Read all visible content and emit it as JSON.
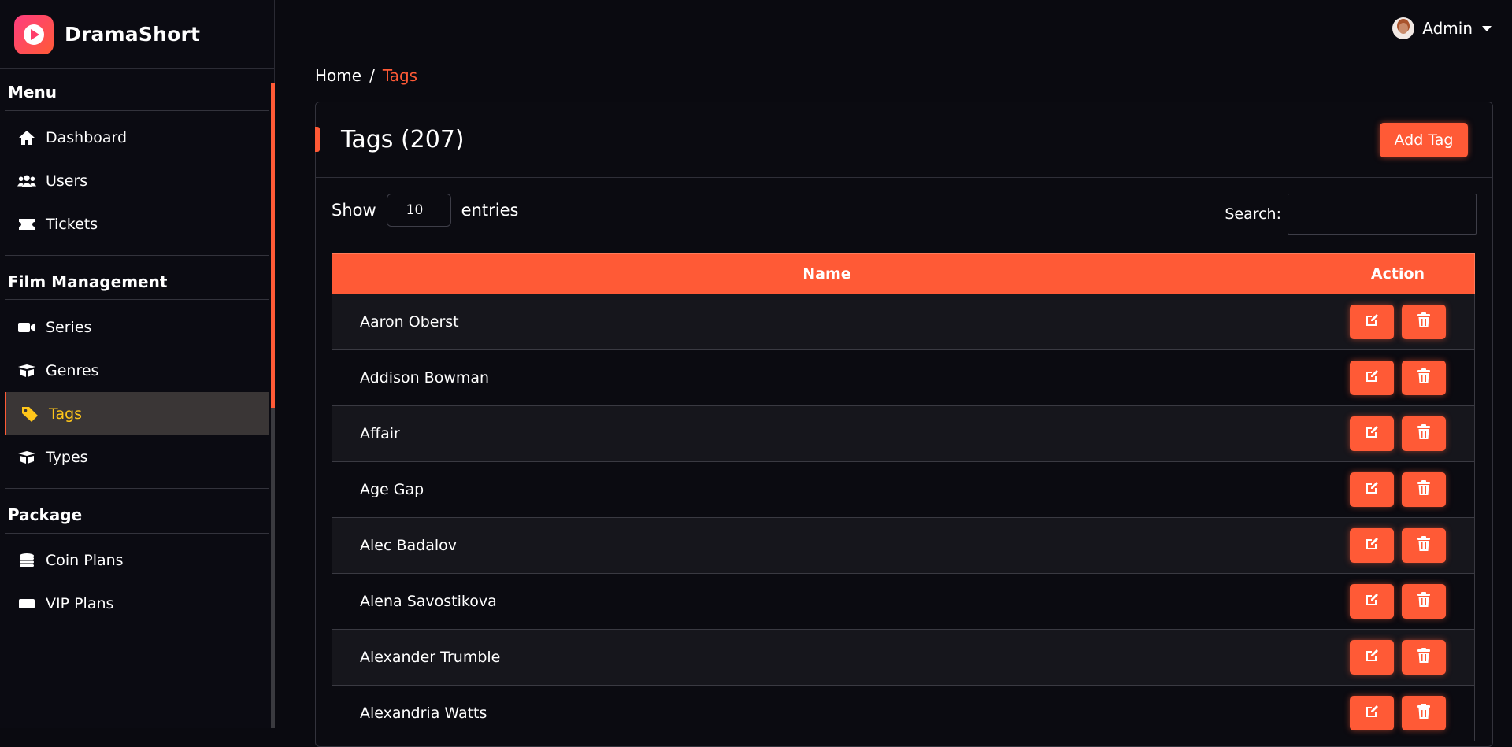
{
  "app": {
    "name": "DramaShort",
    "colors": {
      "accent": "#ff5a36",
      "active_text": "#ffc61a"
    }
  },
  "sidebar": {
    "sections": [
      {
        "title": "Menu",
        "items": [
          {
            "label": "Dashboard",
            "icon": "home-icon"
          },
          {
            "label": "Users",
            "icon": "users-icon"
          },
          {
            "label": "Tickets",
            "icon": "ticket-icon"
          }
        ]
      },
      {
        "title": "Film Management",
        "items": [
          {
            "label": "Series",
            "icon": "video-icon"
          },
          {
            "label": "Genres",
            "icon": "box-icon"
          },
          {
            "label": "Tags",
            "icon": "tag-icon",
            "active": true
          },
          {
            "label": "Types",
            "icon": "box-icon"
          }
        ]
      },
      {
        "title": "Package",
        "items": [
          {
            "label": "Coin Plans",
            "icon": "coins-icon"
          },
          {
            "label": "VIP Plans",
            "icon": "vip-icon"
          }
        ]
      }
    ]
  },
  "topbar": {
    "user": "Admin"
  },
  "breadcrumb": {
    "home": "Home",
    "separator": "/",
    "current": "Tags"
  },
  "card": {
    "title": "Tags (207)",
    "add_button": "Add Tag"
  },
  "controls": {
    "show_label": "Show",
    "entries_value": "10",
    "entries_label": "entries",
    "search_label": "Search:",
    "search_value": ""
  },
  "table": {
    "headers": {
      "name": "Name",
      "action": "Action"
    },
    "rows": [
      "Aaron Oberst",
      "Addison Bowman",
      "Affair",
      "Age Gap",
      "Alec Badalov",
      "Alena Savostikova",
      "Alexander Trumble",
      "Alexandria Watts"
    ]
  }
}
